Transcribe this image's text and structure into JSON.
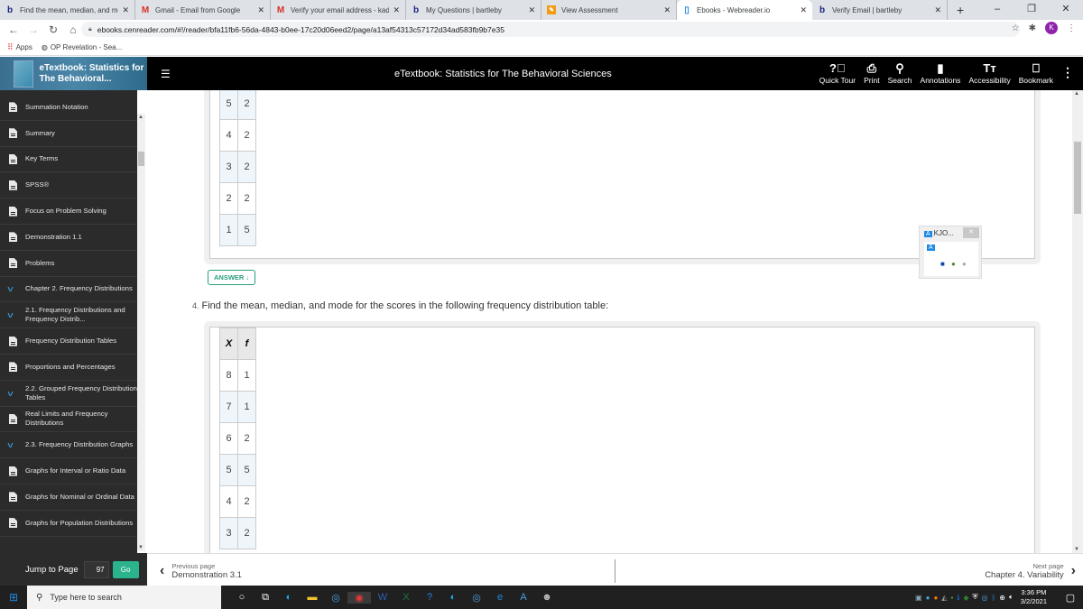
{
  "browser": {
    "tabs": [
      {
        "title": "Find the mean, median, and mod",
        "favicon": "bartleby-b-icon",
        "active": false
      },
      {
        "title": "Gmail - Email from Google",
        "favicon": "gmail-icon",
        "active": false
      },
      {
        "title": "Verify your email address - kade",
        "favicon": "gmail-icon",
        "active": false
      },
      {
        "title": "My Questions | bartleby",
        "favicon": "bartleby-b-icon",
        "active": false
      },
      {
        "title": "View Assessment",
        "favicon": "pencil-icon",
        "active": false
      },
      {
        "title": "Ebooks - Webreader.io",
        "favicon": "book-icon",
        "active": true
      },
      {
        "title": "Verify Email | bartleby",
        "favicon": "bartleby-b-icon",
        "active": false
      }
    ],
    "url": "ebooks.cenreader.com/#!/reader/bfa11fb6-56da-4843-b0ee-17c20d06eed2/page/a13af54313c57172d34ad583fb9b7e35",
    "profile_initial": "K",
    "bookmarks": [
      {
        "label": "Apps"
      },
      {
        "label": "OP Revelation - Sea..."
      }
    ]
  },
  "reader": {
    "book_title": "eTextbook: Statistics for The Behavioral...",
    "header_title": "eTextbook: Statistics for The Behavioral Sciences",
    "tools": [
      {
        "label": "Quick Tour",
        "icon": "question-circle-icon"
      },
      {
        "label": "Print",
        "icon": "printer-icon"
      },
      {
        "label": "Search",
        "icon": "search-icon"
      },
      {
        "label": "Annotations",
        "icon": "annotations-icon"
      },
      {
        "label": "Accessibility",
        "icon": "text-size-icon"
      },
      {
        "label": "Bookmark",
        "icon": "bookmark-icon"
      }
    ]
  },
  "sidebar": {
    "items": [
      {
        "label": "Summation Notation",
        "type": "doc"
      },
      {
        "label": "Summary",
        "type": "doc"
      },
      {
        "label": "Key Terms",
        "type": "doc"
      },
      {
        "label": "SPSS®",
        "type": "doc"
      },
      {
        "label": "Focus on Problem Solving",
        "type": "doc"
      },
      {
        "label": "Demonstration 1.1",
        "type": "doc"
      },
      {
        "label": "Problems",
        "type": "doc"
      },
      {
        "label": "Chapter 2. Frequency Distributions",
        "type": "section"
      },
      {
        "label": "2.1. Frequency Distributions and Frequency Distrib...",
        "type": "section"
      },
      {
        "label": "Frequency Distribution Tables",
        "type": "doc"
      },
      {
        "label": "Proportions and Percentages",
        "type": "doc"
      },
      {
        "label": "2.2. Grouped Frequency Distribution Tables",
        "type": "section"
      },
      {
        "label": "Real Limits and Frequency Distributions",
        "type": "doc"
      },
      {
        "label": "2.3. Frequency Distribution Graphs",
        "type": "section"
      },
      {
        "label": "Graphs for Interval or Ratio Data",
        "type": "doc"
      },
      {
        "label": "Graphs for Nominal or Ordinal Data",
        "type": "doc"
      },
      {
        "label": "Graphs for Population Distributions",
        "type": "doc"
      }
    ],
    "jump_label": "Jump to Page",
    "jump_value": "97",
    "go_label": "Go"
  },
  "content": {
    "table1_rows": [
      {
        "x": "5",
        "f": "2"
      },
      {
        "x": "4",
        "f": "2"
      },
      {
        "x": "3",
        "f": "2"
      },
      {
        "x": "2",
        "f": "2"
      },
      {
        "x": "1",
        "f": "5"
      }
    ],
    "answer_label": "ANSWER ↓",
    "question_number": "4.",
    "question_text": "Find the mean, median, and mode for the scores in the following frequency distribution table:",
    "table2_headers": {
      "x": "X",
      "f": "f"
    },
    "table2_rows": [
      {
        "x": "8",
        "f": "1"
      },
      {
        "x": "7",
        "f": "1"
      },
      {
        "x": "6",
        "f": "2"
      },
      {
        "x": "5",
        "f": "5"
      },
      {
        "x": "4",
        "f": "2"
      },
      {
        "x": "3",
        "f": "2"
      }
    ]
  },
  "widget": {
    "title": "KJO..."
  },
  "footer": {
    "prev_label": "Previous page",
    "prev_title": "Demonstration 3.1",
    "next_label": "Next page",
    "next_title": "Chapter 4. Variability"
  },
  "taskbar": {
    "search_placeholder": "Type here to search",
    "time": "3:36 PM",
    "date": "3/2/2021"
  }
}
